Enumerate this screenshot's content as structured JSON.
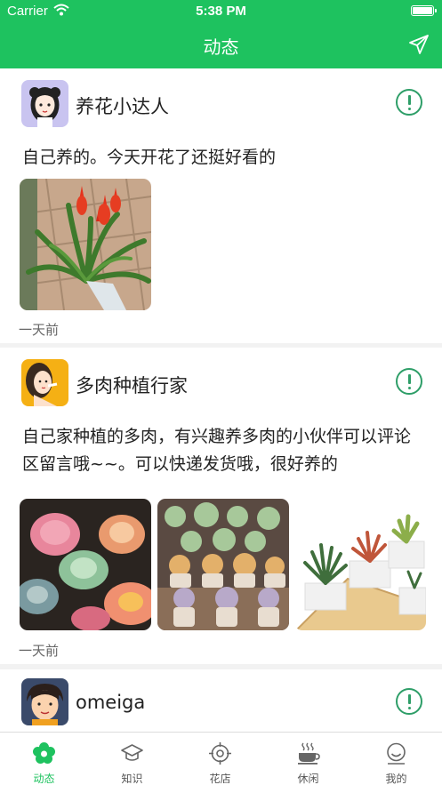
{
  "status_bar": {
    "carrier": "Carrier",
    "time": "5:38 PM"
  },
  "header": {
    "title": "动态"
  },
  "posts": [
    {
      "author": "养花小达人",
      "content": "自己养的。今天开花了还挺好看的",
      "timestamp": "一天前"
    },
    {
      "author": "多肉种植行家",
      "content": "自己家种植的多肉，有兴趣养多肉的小伙伴可以评论区留言哦~~。可以快递发货哦，很好养的",
      "timestamp": "一天前"
    },
    {
      "author": "omeiga"
    }
  ],
  "tabs": [
    {
      "label": "动态",
      "icon": "flower-icon",
      "active": true
    },
    {
      "label": "知识",
      "icon": "graduation-cap-icon"
    },
    {
      "label": "花店",
      "icon": "target-icon"
    },
    {
      "label": "休闲",
      "icon": "coffee-cup-icon"
    },
    {
      "label": "我的",
      "icon": "smiley-icon"
    }
  ],
  "colors": {
    "accent": "#1ec25f",
    "report": "#2e9e68",
    "background": "#f2f2f2"
  }
}
